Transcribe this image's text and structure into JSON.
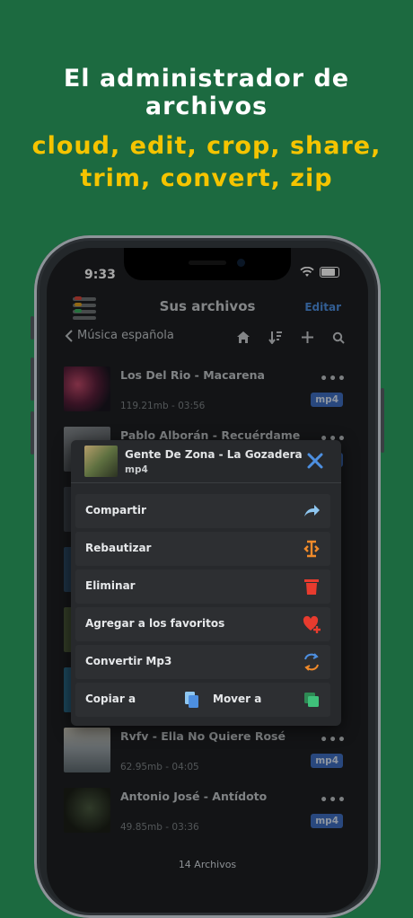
{
  "promo": {
    "headline": "El administrador de archivos",
    "features_line1": "cloud, edit, crop, share,",
    "features_line2": "trim, convert, zip"
  },
  "status_bar": {
    "time": "9:33"
  },
  "header": {
    "title": "Sus archivos",
    "edit_label": "Editar"
  },
  "nav": {
    "back_label": "Música española"
  },
  "files": [
    {
      "name": "Los Del Rio - Macarena",
      "meta": "119.21mb - 03:56",
      "ext": "mp4"
    },
    {
      "name": "Pablo Alborán - Recuérdame",
      "meta": "",
      "ext": "mp4"
    },
    {
      "name": "Rvfv - Ella No Quiere Rosé",
      "meta": "62.95mb - 04:05",
      "ext": "mp4"
    },
    {
      "name": "Antonio José - Antídoto",
      "meta": "49.85mb - 03:36",
      "ext": "mp4"
    }
  ],
  "footer": {
    "count": "14 Archivos"
  },
  "sheet": {
    "file_name": "Gente De Zona - La Gozadera",
    "file_ext": "mp4",
    "actions": {
      "share": "Compartir",
      "rename": "Rebautizar",
      "delete": "Eliminar",
      "favorite": "Agregar a los favoritos",
      "convert": "Convertir Mp3",
      "copy": "Copiar a",
      "move": "Mover a"
    }
  },
  "colors": {
    "background": "#1c6a40",
    "headline": "#ffffff",
    "features": "#f5c400",
    "accent": "#4d8fe0",
    "badge": "#3f6fc2"
  }
}
